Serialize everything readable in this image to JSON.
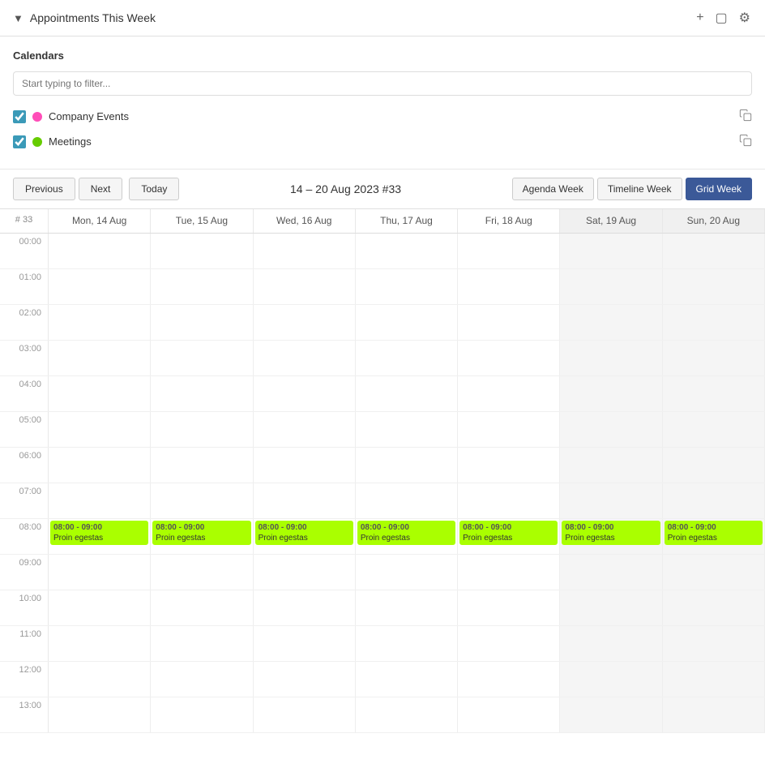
{
  "header": {
    "title": "Appointments This Week",
    "chevron": "▾",
    "icons": [
      "plus-icon",
      "sidebar-icon",
      "gear-icon"
    ]
  },
  "calendars": {
    "section_title": "Calendars",
    "filter_placeholder": "Start typing to filter...",
    "items": [
      {
        "id": "company",
        "label": "Company Events",
        "color": "#ff4db8",
        "checked": true
      },
      {
        "id": "meetings",
        "label": "Meetings",
        "color": "#66cc00",
        "checked": true
      }
    ]
  },
  "toolbar": {
    "prev_label": "Previous",
    "next_label": "Next",
    "today_label": "Today",
    "week_title": "14 – 20 Aug 2023 #33",
    "views": [
      {
        "id": "agenda",
        "label": "Agenda Week",
        "active": false
      },
      {
        "id": "timeline",
        "label": "Timeline Week",
        "active": false
      },
      {
        "id": "grid",
        "label": "Grid Week",
        "active": true
      }
    ]
  },
  "grid": {
    "week_num": "# 33",
    "columns": [
      {
        "label": "Mon, 14 Aug",
        "weekend": false
      },
      {
        "label": "Tue, 15 Aug",
        "weekend": false
      },
      {
        "label": "Wed, 16 Aug",
        "weekend": false
      },
      {
        "label": "Thu, 17 Aug",
        "weekend": false
      },
      {
        "label": "Fri, 18 Aug",
        "weekend": false
      },
      {
        "label": "Sat, 19 Aug",
        "weekend": true
      },
      {
        "label": "Sun, 20 Aug",
        "weekend": true
      }
    ],
    "hours": [
      "00:00",
      "01:00",
      "02:00",
      "03:00",
      "04:00",
      "05:00",
      "06:00",
      "07:00",
      "08:00",
      "09:00",
      "10:00",
      "11:00",
      "12:00",
      "13:00"
    ],
    "event_hour_index": 8,
    "event": {
      "time": "08:00 - 09:00",
      "title": "Proin egestas"
    }
  }
}
